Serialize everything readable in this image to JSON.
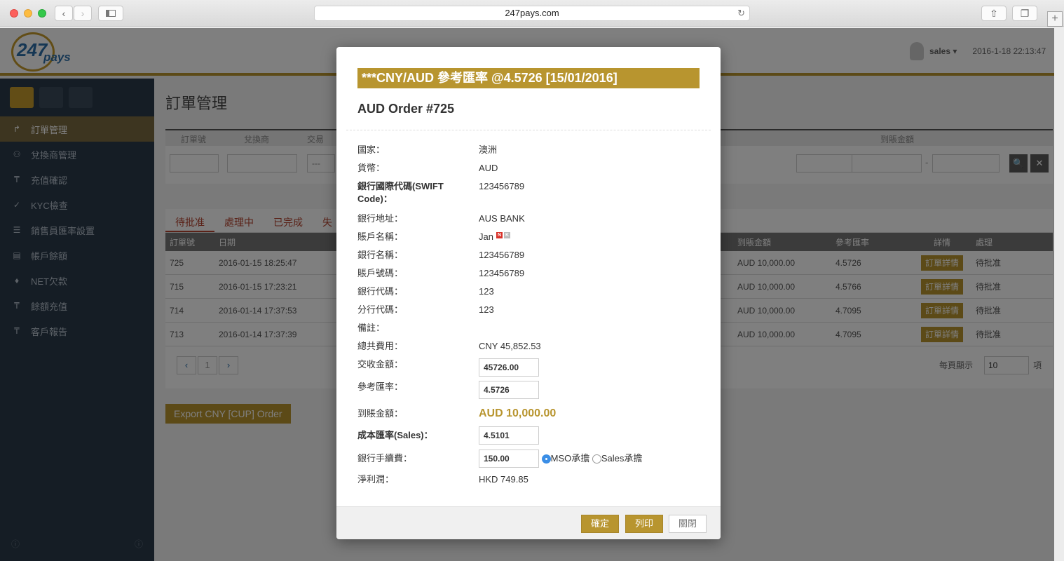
{
  "browser": {
    "url": "247pays.com"
  },
  "header": {
    "logo_num": "247",
    "logo_pays": "pays",
    "user": "sales",
    "user_caret": "▾",
    "datetime": "2016-1-18 22:13:47"
  },
  "sidebar": {
    "items": [
      {
        "label": "訂單管理",
        "icon": "↱"
      },
      {
        "label": "兌換商管理",
        "icon": "⚇"
      },
      {
        "label": "充值確認",
        "icon": "₸"
      },
      {
        "label": "KYC檢查",
        "icon": "✓"
      },
      {
        "label": "銷售員匯率設置",
        "icon": "☰"
      },
      {
        "label": "帳戶餘額",
        "icon": "▤"
      },
      {
        "label": "NET欠款",
        "icon": "♦"
      },
      {
        "label": "餘額充值",
        "icon": "₸"
      },
      {
        "label": "客戶報告",
        "icon": "₸"
      }
    ]
  },
  "main": {
    "title": "訂單管理",
    "filter_headers": [
      "訂單號",
      "兌換商",
      "交易"
    ],
    "filter_last_header": "到賬金額",
    "filter_select": "---",
    "range_sep": "-",
    "search_icon": "🔍",
    "clear_icon": "✕",
    "tabs": [
      "待批准",
      "處理中",
      "已完成",
      "失"
    ],
    "grid_headers": {
      "order_no": "訂單號",
      "date": "日期",
      "amount": "到賬金額",
      "rate": "參考匯率",
      "detail": "詳情",
      "process": "處理"
    },
    "rows": [
      {
        "order_no": "725",
        "date": "2016-01-15 18:25:47",
        "amount": "AUD 10,000.00",
        "rate": "4.5726",
        "detail": "訂單詳情",
        "status": "待批准"
      },
      {
        "order_no": "715",
        "date": "2016-01-15 17:23:21",
        "amount": "AUD 10,000.00",
        "rate": "4.5766",
        "detail": "訂單詳情",
        "status": "待批准"
      },
      {
        "order_no": "714",
        "date": "2016-01-14 17:37:53",
        "amount": "AUD 10,000.00",
        "rate": "4.7095",
        "detail": "訂單詳情",
        "status": "待批准"
      },
      {
        "order_no": "713",
        "date": "2016-01-14 17:37:39",
        "amount": "AUD 10,000.00",
        "rate": "4.7095",
        "detail": "訂單詳情",
        "status": "待批准"
      }
    ],
    "pager": {
      "prev": "‹",
      "page": "1",
      "next": "›",
      "per_page_label": "每頁顯示",
      "per_page": "10",
      "unit": "項"
    },
    "export_label": "Export CNY [CUP] Order"
  },
  "modal": {
    "rate_banner": "***CNY/AUD 參考匯率 @4.5726 [15/01/2016]",
    "title": "AUD Order #725",
    "fields": {
      "country_label": "國家：",
      "country": "澳洲",
      "currency_label": "貨幣：",
      "currency": "AUD",
      "swift_label": "銀行國際代碼(SWIFT Code)：",
      "swift": "123456789",
      "bank_address_label": "銀行地址：",
      "bank_address": "AUS BANK",
      "account_name_label": "賬戶名稱：",
      "account_name": "Jan",
      "badge_n": "N",
      "badge_k": "K",
      "bank_name_label": "銀行名稱：",
      "bank_name": "123456789",
      "account_no_label": "賬戶號碼：",
      "account_no": "123456789",
      "bank_code_label": "銀行代碼：",
      "bank_code": "123",
      "branch_code_label": "分行代碼：",
      "branch_code": "123",
      "remark_label": "備註：",
      "total_fee_label": "總共費用：",
      "total_fee": "CNY 45,852.53",
      "received_label": "交收金額：",
      "received": "45726.00",
      "ref_rate_label": "參考匯率：",
      "ref_rate": "4.5726",
      "credit_amount_label": "到賬金額：",
      "credit_amount": "AUD 10,000.00",
      "cost_rate_label": "成本匯率(Sales)：",
      "cost_rate": "4.5101",
      "bank_fee_label": "銀行手續費：",
      "bank_fee": "150.00",
      "radio_mso": "MSO承擔",
      "radio_sales": "Sales承擔",
      "net_profit_label": "淨利潤：",
      "net_profit": "HKD 749.85"
    },
    "buttons": {
      "confirm": "確定",
      "print": "列印",
      "close": "關閉"
    }
  },
  "colors": {
    "accent": "#b8952f",
    "sidebar": "#2b3a4a"
  }
}
